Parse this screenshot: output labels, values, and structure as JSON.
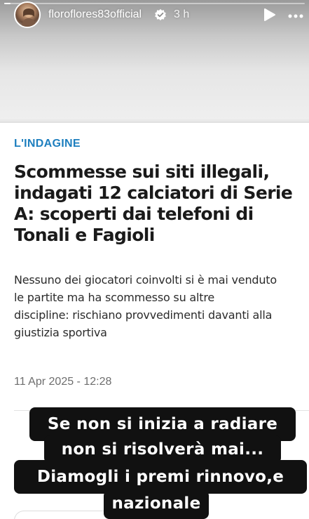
{
  "story": {
    "username": "floroflores83official",
    "time_ago": "3 h",
    "progress": 0.02
  },
  "article": {
    "section": "L'INDAGINE",
    "headline_lines": [
      "Scommesse sui siti illegali,",
      "indagati 12 calciatori di Serie",
      "A: scoperti dai telefoni di",
      "Tonali e Fagioli"
    ],
    "summary_lines": [
      "Nessuno dei giocatori coinvolti si è mai venduto",
      "le partite ma ha scommesso su altre",
      "discipline: rischiano provvedimenti davanti alla",
      "giustizia sportiva"
    ],
    "date": "11 Apr 2025 - 12:28"
  },
  "captions": [
    "Se non si inizia a radiare",
    "non si risolverà mai...",
    "Diamogli i premi rinnovo,e",
    "nazionale"
  ],
  "colors": {
    "section_accent": "#1e7fbf",
    "caption_bg": "#111111"
  },
  "icons": {
    "verified": "verified-badge-icon",
    "play": "play-icon",
    "more": "more-options-icon"
  }
}
